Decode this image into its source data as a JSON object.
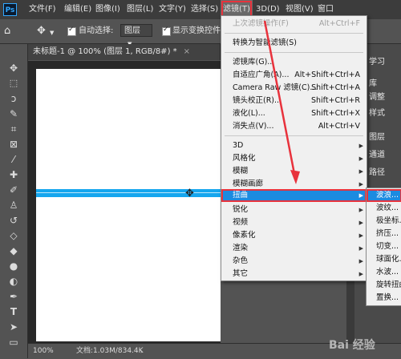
{
  "app": {
    "logo": "Ps"
  },
  "menubar": {
    "items": [
      "文件(F)",
      "编辑(E)",
      "图像(I)",
      "图层(L)",
      "文字(Y)",
      "选择(S)",
      "滤镜(T)",
      "3D(D)",
      "视图(V)",
      "窗口"
    ],
    "active_index": 6
  },
  "options_bar": {
    "auto_select_label": "自动选择:",
    "auto_select_value": "图层",
    "show_transform_label": "显示变换控件"
  },
  "document": {
    "tab_title": "未标题-1 @ 100% (图层 1, RGB/8#) *",
    "close_glyph": "×",
    "accent_color": "#16a6ee"
  },
  "status_bar": {
    "zoom": "100%",
    "doc_info": "文档:1.03M/834.4K"
  },
  "right_panel": {
    "items": [
      "学习",
      "库",
      "调整",
      "样式",
      "图层",
      "通道",
      "路径"
    ]
  },
  "filter_menu": {
    "items": [
      {
        "label": "上次滤镜操作(F)",
        "shortcut": "Alt+Ctrl+F",
        "disabled": true
      },
      {
        "label": "转换为智能滤镜(S)",
        "shortcut": ""
      },
      {
        "label": "滤镜库(G)...",
        "shortcut": ""
      },
      {
        "label": "自适应广角(A)...",
        "shortcut": "Alt+Shift+Ctrl+A"
      },
      {
        "label": "Camera Raw 滤镜(C)...",
        "shortcut": "Shift+Ctrl+A"
      },
      {
        "label": "镜头校正(R)...",
        "shortcut": "Shift+Ctrl+R"
      },
      {
        "label": "液化(L)...",
        "shortcut": "Shift+Ctrl+X"
      },
      {
        "label": "消失点(V)...",
        "shortcut": "Alt+Ctrl+V"
      },
      {
        "label": "3D",
        "submenu": true
      },
      {
        "label": "风格化",
        "submenu": true
      },
      {
        "label": "模糊",
        "submenu": true
      },
      {
        "label": "模糊画廊",
        "submenu": true
      },
      {
        "label": "扭曲",
        "submenu": true,
        "highlighted": true
      },
      {
        "label": "锐化",
        "submenu": true
      },
      {
        "label": "视频",
        "submenu": true
      },
      {
        "label": "像素化",
        "submenu": true
      },
      {
        "label": "渲染",
        "submenu": true
      },
      {
        "label": "杂色",
        "submenu": true
      },
      {
        "label": "其它",
        "submenu": true
      }
    ]
  },
  "distort_submenu": {
    "items": [
      "波浪...",
      "波纹...",
      "极坐标...",
      "挤压...",
      "切变...",
      "球面化...",
      "水波...",
      "旋转扭曲...",
      "置换..."
    ],
    "highlighted_index": 0
  },
  "watermark": "Bai 经验",
  "colors": {
    "highlight": "#1c8be0",
    "annotation": "#e8323c"
  }
}
